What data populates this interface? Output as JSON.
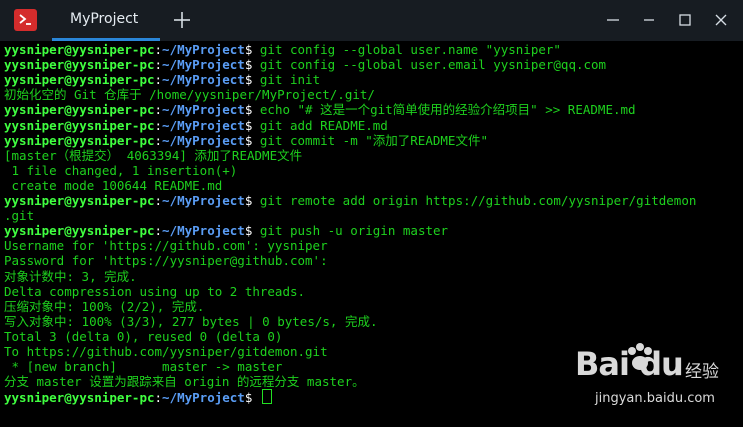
{
  "titlebar": {
    "tab_label": "MyProject",
    "app_icon": "terminal-icon",
    "new_tab_icon": "plus-icon",
    "window_buttons": [
      "minimize-icon",
      "maximize-icon",
      "close-icon"
    ]
  },
  "prompt": {
    "user": "yysniper@yysniper-pc",
    "path": "~/MyProject",
    "symbol": "$"
  },
  "terminal_lines": [
    {
      "type": "cmd",
      "text": "git config --global user.name \"yysniper\""
    },
    {
      "type": "cmd",
      "text": "git config --global user.email yysniper@qq.com"
    },
    {
      "type": "cmd",
      "text": "git init"
    },
    {
      "type": "out",
      "text": "初始化空的 Git 仓库于 /home/yysniper/MyProject/.git/"
    },
    {
      "type": "cmd",
      "text": "echo \"# 这是一个git简单使用的经验介绍项目\" >> README.md"
    },
    {
      "type": "cmd",
      "text": "git add README.md"
    },
    {
      "type": "cmd",
      "text": "git commit -m \"添加了README文件\""
    },
    {
      "type": "out",
      "text": "[master（根提交） 4063394] 添加了README文件"
    },
    {
      "type": "out",
      "text": " 1 file changed, 1 insertion(+)"
    },
    {
      "type": "out",
      "text": " create mode 100644 README.md"
    },
    {
      "type": "cmd",
      "text": "git remote add origin https://github.com/yysniper/gitdemon"
    },
    {
      "type": "out",
      "text": ".git"
    },
    {
      "type": "cmd",
      "text": "git push -u origin master"
    },
    {
      "type": "out",
      "text": "Username for 'https://github.com': yysniper"
    },
    {
      "type": "out",
      "text": "Password for 'https://yysniper@github.com':"
    },
    {
      "type": "out",
      "text": "对象计数中: 3, 完成."
    },
    {
      "type": "out",
      "text": "Delta compression using up to 2 threads."
    },
    {
      "type": "out",
      "text": "压缩对象中: 100% (2/2), 完成."
    },
    {
      "type": "out",
      "text": "写入对象中: 100% (3/3), 277 bytes | 0 bytes/s, 完成."
    },
    {
      "type": "out",
      "text": "Total 3 (delta 0), reused 0 (delta 0)"
    },
    {
      "type": "out",
      "text": "To https://github.com/yysniper/gitdemon.git"
    },
    {
      "type": "out",
      "text": " * [new branch]      master -> master"
    },
    {
      "type": "out",
      "text": "分支 master 设置为跟踪来自 origin 的远程分支 master。"
    },
    {
      "type": "cmd",
      "text": ""
    }
  ],
  "watermark": {
    "logo": "Bai du",
    "text": "经验",
    "url": "jingyan.baidu.com"
  },
  "colors": {
    "background": "#000000",
    "titlebar": "#171c22",
    "prompt_user": "#40ff40",
    "prompt_path": "#5a9df5",
    "output": "#1ed11e",
    "tab_accent": "#2a86d8",
    "app_icon": "#d42c2c"
  }
}
